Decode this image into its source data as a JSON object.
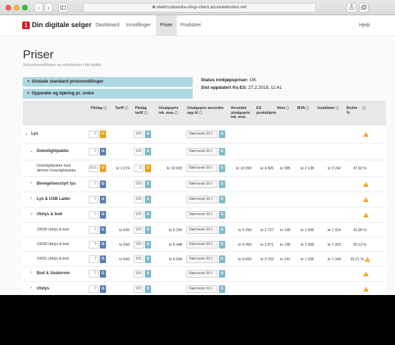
{
  "browser": {
    "url": "elektroskandia-shop-client.azurewebsites.net",
    "back_glyph": "‹",
    "forward_glyph": "›"
  },
  "header": {
    "logo_mark": "1",
    "logo_text": "Din digitale selger",
    "nav": [
      "Dashboard",
      "Innstillinger",
      "Priser",
      "Produkter"
    ],
    "active_nav": "Priser",
    "help": "Hjelp"
  },
  "page": {
    "title": "Priser",
    "subtitle": "Sett prisinnstillinger og enkeltpriser i din butikk.",
    "accordion_global": "Globale standard prisinnstillinger",
    "accordion_oppmote": "Oppmøte og kjøring pr. ordre",
    "accordion_plus": "+",
    "status_label": "Status innkjøpspriser:",
    "status_value": "OK",
    "updated_label": "Sist oppdatert fra ES:",
    "updated_value": "27.2.2018, 11:41"
  },
  "table": {
    "headers": {
      "paslag": "Påslag",
      "tariff": "Tariff",
      "paslag_tariff": "Påslag tariff",
      "utsalgspris": "Utsalgspris ink. mva.",
      "utsalgspris_avrundes": "Utsalgspris avrundes opp til",
      "avrundet": "Avrundet utsalgspris ink. mva.",
      "es_produktpris": "ES produktpris",
      "nets": "Nets",
      "mva": "MVA",
      "installator": "Installatør",
      "brutto": "Brutto %"
    },
    "select_placeholder": "Nærmeste 90 ℓ",
    "select_arrow": "⇕",
    "btn_g": "G",
    "btn_o": "O",
    "btn_s": "S",
    "chevron_open": "⌄",
    "chevron_closed": "›",
    "warn_glyph": "!",
    "rows": {
      "lys": {
        "label": "Lys",
        "paslag": "7",
        "paslag_tariff": "100"
      },
      "downlightpakke": {
        "label": "Downlightpakke",
        "paslag": "7",
        "paslag_tariff": "100"
      },
      "dimmer": {
        "label_line1": "Downlightpakke med",
        "label_line2": "dimmer Downlightpakke",
        "paslag": "10.0",
        "tariff": "kr 1 074",
        "paslag_tariff": "2",
        "utsalgspris": "kr 10 603",
        "avrundet": "kr 10 690",
        "es": "kr 4 925",
        "nets": "kr 385",
        "mva": "kr 2 138",
        "inst": "kr 3 242",
        "brutto": "37,92 %"
      },
      "bevegelse": {
        "label": "Bevegelsesstyrt lys",
        "paslag": "7",
        "paslag_tariff": "100"
      },
      "usb": {
        "label": "Lys & USB Lader",
        "paslag": "7",
        "paslag_tariff": "100"
      },
      "utelys_bod": {
        "label": "Utelys & bod",
        "paslag": "7",
        "paslag_tariff": "100"
      },
      "u10029": {
        "label": "10029 Utelys & bod",
        "paslag": "7",
        "tariff": "kr 643",
        "paslag_tariff": "100",
        "utsalgspris": "kr 5 255",
        "avrundet": "kr 5 290",
        "es": "kr 2 727",
        "nets": "kr 190",
        "mva": "kr 1 058",
        "inst": "kr 1 314",
        "brutto": "31,05 %"
      },
      "u10030": {
        "label": "10030 Utelys & bod",
        "paslag": "7",
        "tariff": "kr 643",
        "paslag_tariff": "100",
        "utsalgspris": "kr 5 448",
        "avrundet": "kr 5 490",
        "es": "kr 2 871",
        "nets": "kr 198",
        "mva": "kr 1 098",
        "inst": "kr 1 323",
        "brutto": "30,13 %"
      },
      "u10031": {
        "label": "10031 Utelys & bod",
        "paslag": "7",
        "tariff": "kr 643",
        "paslag_tariff": "100",
        "utsalgspris": "kr 6 640",
        "avrundet": "kr 6 690",
        "es": "kr 3 762",
        "nets": "kr 241",
        "mva": "kr 1 338",
        "inst": "kr 1 349",
        "brutto": "25,21 %"
      },
      "bod": {
        "label": "Bod & Vaskerom",
        "paslag": "7",
        "paslag_tariff": "100"
      },
      "utelys": {
        "label": "Utelys",
        "paslag": "7",
        "paslag_tariff": "100"
      }
    }
  },
  "colors": {
    "accent_blue": "#5b80b7",
    "accent_orange": "#e8a317",
    "accent_lightblue": "#7fb9cf",
    "accordion_bg": "#aed9e3",
    "warning": "#f0a21b",
    "brand_red": "#d71920"
  }
}
